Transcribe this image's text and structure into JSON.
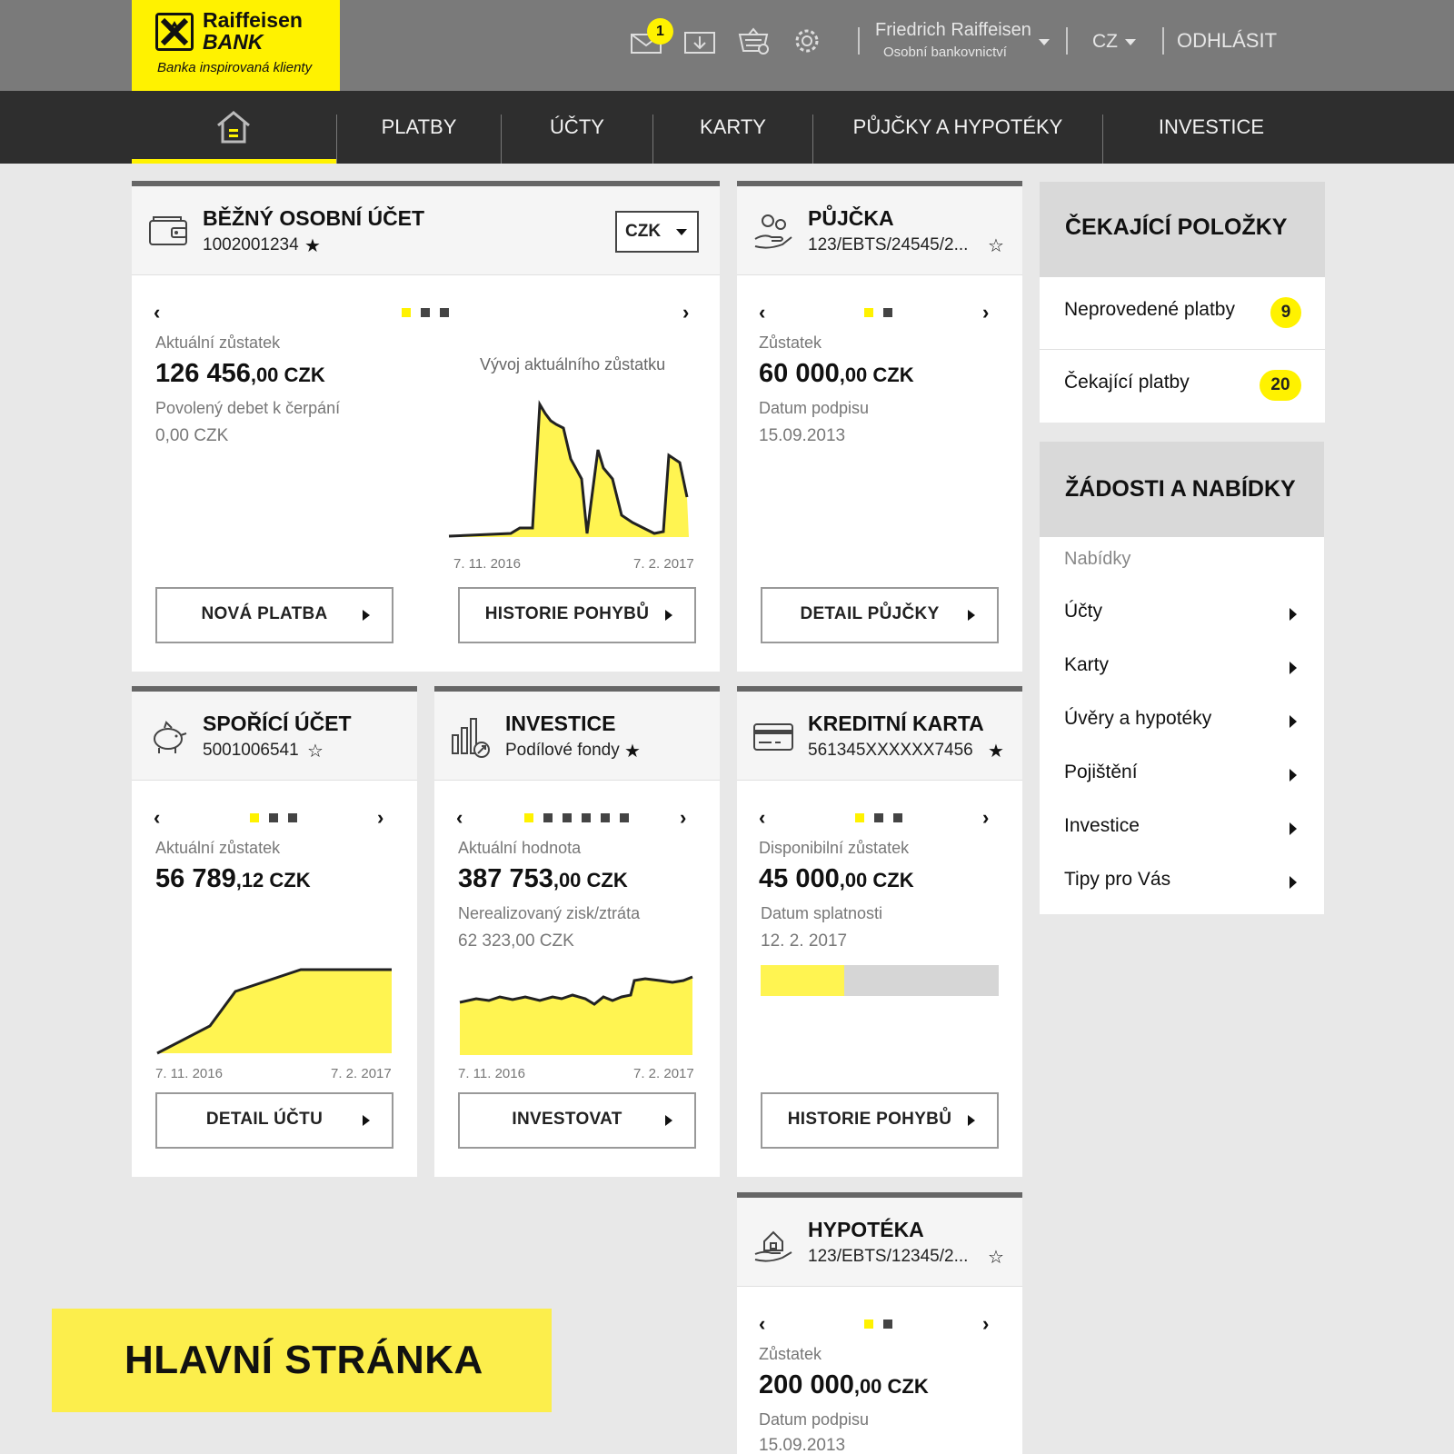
{
  "brand": {
    "name_line1": "Raiffeisen",
    "name_line2": "BANK",
    "tagline": "Banka inspirovaná klienty",
    "accent": "#fff200"
  },
  "header": {
    "icons": [
      "mail-icon",
      "download-icon",
      "basket-icon",
      "gear-icon"
    ],
    "mail_badge": "1",
    "user_name": "Friedrich Raiffeisen",
    "user_role": "Osobní bankovnictví",
    "language": "CZ",
    "logout": "ODHLÁSIT"
  },
  "nav": {
    "items": [
      "PLATBY",
      "ÚČTY",
      "KARTY",
      "PŮJČKY A HYPOTÉKY",
      "INVESTICE"
    ]
  },
  "cards": {
    "current": {
      "title": "BĚŽNÝ OSOBNÍ ÚČET",
      "number": "1002001234",
      "star": "★",
      "currency": "CZK",
      "balance_label": "Aktuální zůstatek",
      "balance_main": "126 456",
      "balance_decimal": ",00 CZK",
      "overdraft_label": "Povolený debet k čerpání",
      "overdraft_value": "0,00 CZK",
      "chart_title": "Vývoj aktuálního zůstatku",
      "x_start": "7. 11. 2016",
      "x_end": "7. 2. 2017",
      "btn1": "NOVÁ PLATBA",
      "btn2": "HISTORIE POHYBŮ",
      "pages": 3,
      "active_page": 0
    },
    "loan": {
      "title": "PŮJČKA",
      "number": "123/EBTS/24545/2...",
      "star": "☆",
      "balance_label": "Zůstatek",
      "balance_main": "60 000",
      "balance_decimal": ",00 CZK",
      "date_label": "Datum podpisu",
      "date_value": "15.09.2013",
      "btn": "DETAIL PŮJČKY",
      "pages": 2,
      "active_page": 0
    },
    "savings": {
      "title": "SPOŘÍCÍ ÚČET",
      "number": "5001006541",
      "star": "☆",
      "balance_label": "Aktuální zůstatek",
      "balance_main": "56 789",
      "balance_decimal": ",12 CZK",
      "x_start": "7. 11. 2016",
      "x_end": "7. 2. 2017",
      "btn": "DETAIL ÚČTU",
      "pages": 3,
      "active_page": 0
    },
    "investment": {
      "title": "INVESTICE",
      "number": "Podílové fondy",
      "star": "★",
      "balance_label": "Aktuální hodnota",
      "balance_main": "387 753",
      "balance_decimal": ",00 CZK",
      "pl_label": "Nerealizovaný zisk/ztráta",
      "pl_value": "62 323,00 CZK",
      "x_start": "7. 11. 2016",
      "x_end": "7. 2. 2017",
      "btn": "INVESTOVAT",
      "pages": 6,
      "active_page": 0
    },
    "credit": {
      "title": "KREDITNÍ KARTA",
      "number": "561345XXXXXX7456",
      "star": "★",
      "balance_label": "Disponibilní zůstatek",
      "balance_main": "45 000",
      "balance_decimal": ",00 CZK",
      "due_label": "Datum splatnosti",
      "due_value": "12. 2. 2017",
      "utilization": 0.35,
      "btn": "HISTORIE POHYBŮ",
      "pages": 3,
      "active_page": 0
    },
    "mortgage": {
      "title": "HYPOTÉKA",
      "number": "123/EBTS/12345/2...",
      "star": "☆",
      "balance_label": "Zůstatek",
      "balance_main": "200 000",
      "balance_decimal": ",00 CZK",
      "date_label": "Datum podpisu",
      "date_value": "15.09.2013",
      "pages": 2,
      "active_page": 0
    }
  },
  "pending": {
    "title": "ČEKAJÍCÍ POLOŽKY",
    "items": [
      {
        "label": "Neprovedené platby",
        "count": "9"
      },
      {
        "label": "Čekající platby",
        "count": "20"
      }
    ]
  },
  "offers": {
    "title": "ŽÁDOSTI A NABÍDKY",
    "subtitle": "Nabídky",
    "items": [
      "Účty",
      "Karty",
      "Úvěry a hypotéky",
      "Pojištění",
      "Investice",
      "Tipy pro Vás"
    ]
  },
  "page_label": "HLAVNÍ STRÁNKA"
}
